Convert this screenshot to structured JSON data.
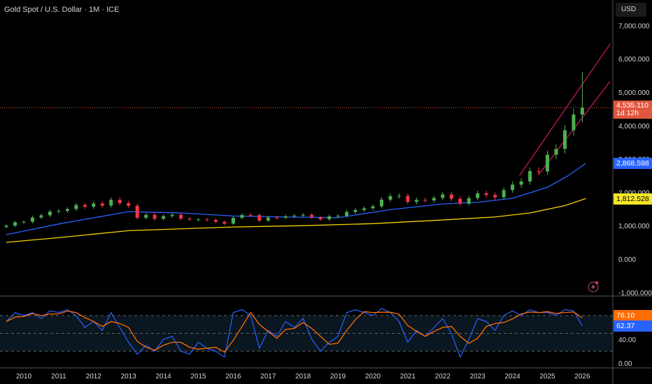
{
  "header": {
    "title": "Gold Spot / U.S. Dollar · 1M · ICE",
    "currency": "USD"
  },
  "badges": {
    "last_price": "4,535.110",
    "countdown": "1d 12h",
    "ma_fast": "2,868.598",
    "ma_slow": "1,812.528",
    "osc_fast": "76.10",
    "osc_slow": "62.37"
  },
  "colors": {
    "up": "#4caf50",
    "down": "#f23645",
    "ma_fast": "#2962ff",
    "ma_slow": "#f5d300",
    "channel": "#c2185b",
    "osc_k": "#2962ff",
    "osc_d": "#ff6d00",
    "last": "#e0573f"
  },
  "chart_data": [
    {
      "type": "candlestick",
      "title": "Gold Spot / U.S. Dollar · 1M · ICE",
      "ylim": [
        -1000,
        7500
      ],
      "y_ticks": [
        "7,000.000",
        "6,000.000",
        "5,000.000",
        "4,000.000",
        "3,000.000",
        "2,000.000",
        "1,000.000",
        "0.000",
        "-1,000.000"
      ],
      "y_tick_values": [
        7000,
        6000,
        5000,
        4000,
        3000,
        2000,
        1000,
        0,
        -1000
      ],
      "x_ticks": [
        "2010",
        "2011",
        "2012",
        "2013",
        "2014",
        "2015",
        "2016",
        "2017",
        "2018",
        "2019",
        "2020",
        "2021",
        "2022",
        "2023",
        "2024",
        "2025",
        "2026"
      ],
      "start": 2009.5,
      "step": 0.25,
      "closes": [
        1000,
        1100,
        1115,
        1245,
        1310,
        1420,
        1440,
        1500,
        1620,
        1565,
        1665,
        1600,
        1775,
        1675,
        1595,
        1235,
        1325,
        1205,
        1285,
        1325,
        1210,
        1185,
        1185,
        1170,
        1115,
        1060,
        1235,
        1320,
        1315,
        1150,
        1245,
        1240,
        1280,
        1300,
        1325,
        1250,
        1190,
        1280,
        1295,
        1410,
        1470,
        1520,
        1580,
        1780,
        1885,
        1895,
        1710,
        1770,
        1755,
        1830,
        1935,
        1805,
        1660,
        1825,
        1970,
        1920,
        1850,
        2065,
        2230,
        2325,
        2635,
        2625,
        3125,
        3300,
        3860,
        4330,
        4535.11
      ],
      "last_high": 5600,
      "last_low": 4100,
      "ma_fast": {
        "t": [
          2009.5,
          2011,
          2013,
          2014.5,
          2016,
          2017.5,
          2019,
          2020.5,
          2022,
          2023,
          2024,
          2025,
          2025.6,
          2026.1
        ],
        "v": [
          730,
          1050,
          1420,
          1380,
          1290,
          1260,
          1240,
          1480,
          1650,
          1700,
          1820,
          2150,
          2500,
          2868.598
        ]
      },
      "ma_slow": {
        "t": [
          2009.5,
          2011,
          2013,
          2016,
          2018,
          2020,
          2022,
          2023.5,
          2024.5,
          2025.5,
          2026.1
        ],
        "v": [
          500,
          640,
          850,
          960,
          1000,
          1060,
          1170,
          1260,
          1380,
          1600,
          1812.528
        ]
      },
      "channel": [
        {
          "t": [
            2024.2,
            2026.8
          ],
          "v": [
            2500,
            6450
          ]
        },
        {
          "t": [
            2024.75,
            2026.8
          ],
          "v": [
            2530,
            5330
          ]
        }
      ],
      "last_price": 4535.11
    },
    {
      "type": "line",
      "title": "Oscillator",
      "ylim": [
        0,
        100
      ],
      "y_ticks": [
        "40.00",
        "0.00"
      ],
      "y_tick_values": [
        40,
        0
      ],
      "bands": [
        80,
        50,
        20
      ],
      "start": 2009.5,
      "step": 0.25,
      "k": [
        70,
        85,
        80,
        85,
        75,
        88,
        85,
        90,
        80,
        60,
        70,
        55,
        85,
        60,
        35,
        15,
        30,
        20,
        40,
        45,
        20,
        15,
        35,
        25,
        20,
        10,
        85,
        90,
        80,
        25,
        55,
        45,
        70,
        60,
        75,
        40,
        20,
        35,
        45,
        85,
        90,
        85,
        80,
        92,
        85,
        70,
        35,
        55,
        45,
        60,
        75,
        50,
        10,
        40,
        75,
        70,
        55,
        80,
        88,
        80,
        90,
        85,
        85,
        80,
        90,
        88,
        62.37
      ],
      "d_last": 76.1
    }
  ]
}
